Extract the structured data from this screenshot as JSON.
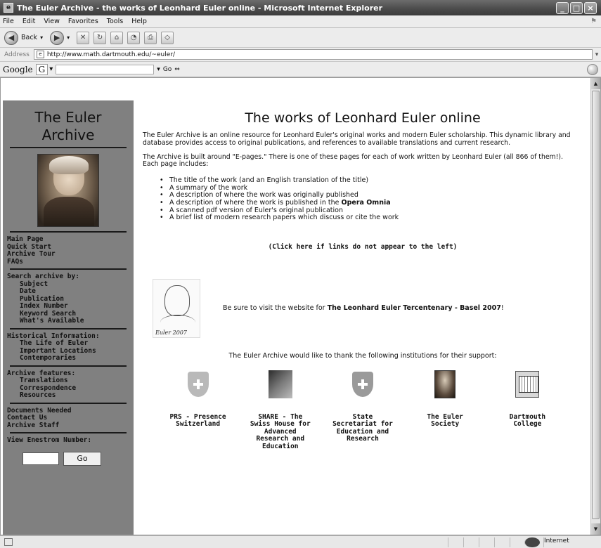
{
  "window": {
    "title": "The Euler Archive - the works of Leonhard Euler online - Microsoft Internet Explorer",
    "controls": {
      "minimize": "_",
      "maximize": "□",
      "close": "×"
    }
  },
  "menu": [
    "File",
    "Edit",
    "View",
    "Favorites",
    "Tools",
    "Help"
  ],
  "toolbar": {
    "back_label": "Back"
  },
  "address": {
    "label": "Address",
    "url": "http://www.math.dartmouth.edu/~euler/"
  },
  "google": {
    "brand": "Google",
    "g_button": "G",
    "go_label": "Go"
  },
  "sidebar": {
    "title_line1": "The Euler",
    "title_line2": "Archive",
    "nav_main": [
      "Main Page",
      "Quick Start",
      "Archive Tour",
      "FAQs"
    ],
    "search": {
      "heading": "Search archive by:",
      "items": [
        "Subject",
        "Date",
        "Publication",
        "Index Number",
        "Keyword Search",
        "What's Available"
      ]
    },
    "historical": {
      "heading": "Historical Information:",
      "items": [
        "The Life of Euler",
        "Important Locations",
        "Contemporaries"
      ]
    },
    "features": {
      "heading": "Archive features:",
      "items": [
        "Translations",
        "Correspondence",
        "Resources"
      ]
    },
    "misc": [
      "Documents Needed",
      "Contact Us",
      "Archive Staff"
    ],
    "enstrom": {
      "label": "View Enestrom Number:",
      "button": "Go"
    }
  },
  "main": {
    "title": "The works of Leonhard Euler online",
    "intro": "The Euler Archive is an online resource for Leonhard Euler's original works and modern Euler scholarship. This dynamic library and database provides access to original publications, and references to available translations and current research.",
    "epages": "The Archive is built around \"E-pages.\" There is one of these pages for each of work written by Leonhard Euler (all 866 of them!).",
    "each_page": "Each page includes:",
    "bullets": [
      "The title of the work (and an English translation of the title)",
      "A summary of the work",
      "A description of where the work was originally published",
      "A description of where the work is published in the",
      "A scanned pdf version of Euler's original publication",
      "A brief list of modern research papers which discuss or cite the work"
    ],
    "opera_omnia": "Opera Omnia",
    "click_here": "(Click here if links do not appear to the left)",
    "sketch_signature": "Euler 2007",
    "visit_prefix": "Be sure to visit the website for",
    "visit_link": "The Leonhard Euler Tercentenary - Basel 2007",
    "visit_suffix": "!",
    "thanks": "The Euler Archive would like to thank the following institutions for their support:",
    "institutions": [
      {
        "name": "PRS - Presence Switzerland"
      },
      {
        "name": "SHARE - The Swiss House for Advanced Research and Education"
      },
      {
        "name": "State Secretariat for Education and Research"
      },
      {
        "name": "The Euler Society"
      },
      {
        "name": "Dartmouth College"
      }
    ]
  },
  "status": {
    "zone": "Internet"
  }
}
